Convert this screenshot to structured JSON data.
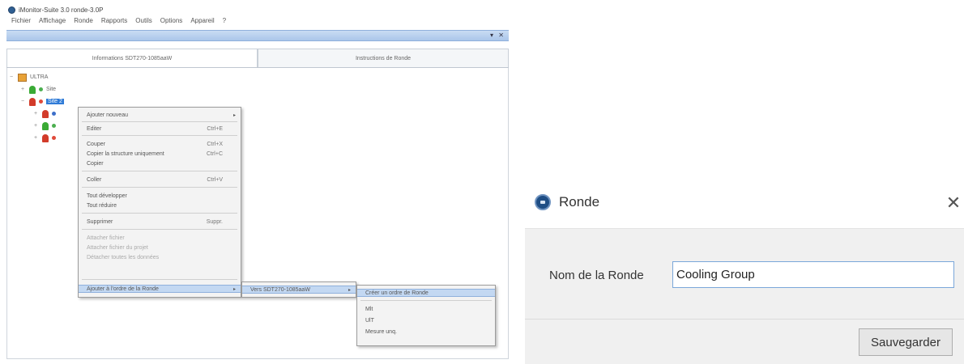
{
  "left_window": {
    "title": "iMonitor-Suite 3.0 ronde-3.0P",
    "menu": [
      "Fichier",
      "Affichage",
      "Ronde",
      "Rapports",
      "Outils",
      "Options",
      "Appareil",
      "?"
    ],
    "window_controls": "▾ ✕",
    "tabs": [
      {
        "label": "Informations SDT270-1085aaW",
        "active": true
      },
      {
        "label": "Instructions de Ronde",
        "active": false
      }
    ],
    "tree": {
      "root": "ULTRA",
      "child1": "Site",
      "child2_selected": "Site 2"
    },
    "context_menu": {
      "items": [
        {
          "label": "Ajouter nouveau",
          "shortcut": "",
          "submenu": true
        },
        {
          "label": "Editer",
          "shortcut": "Ctrl+E"
        },
        {
          "label": "Couper",
          "shortcut": "Ctrl+X"
        },
        {
          "label": "Copier la structure uniquement",
          "shortcut": "Ctrl+C"
        },
        {
          "label": "Copier",
          "shortcut": ""
        },
        {
          "label": "Coller",
          "shortcut": "Ctrl+V"
        },
        {
          "label": "Tout développer",
          "shortcut": ""
        },
        {
          "label": "Tout réduire",
          "shortcut": ""
        },
        {
          "label": "Supprimer",
          "shortcut": "Suppr."
        },
        {
          "label": "Attacher fichier",
          "shortcut": "",
          "disabled": true
        },
        {
          "label": "Attacher fichier du projet",
          "shortcut": "",
          "disabled": true
        },
        {
          "label": "Détacher toutes les données",
          "shortcut": "",
          "disabled": true
        },
        {
          "label": "Ajouter à l'ordre de la Ronde",
          "shortcut": "",
          "submenu": true,
          "highlighted": true
        }
      ],
      "submenu1": {
        "label": "Vers SDT270-1085aaW",
        "submenu": true
      },
      "submenu2": [
        {
          "label": "Créer un ordre de Ronde",
          "highlighted": true
        },
        {
          "label": "Mlt"
        },
        {
          "label": "UlT"
        },
        {
          "label": "Mesure unq."
        }
      ]
    }
  },
  "dialog": {
    "title": "Ronde",
    "close_glyph": "✕",
    "field_label": "Nom de la Ronde",
    "field_value": "Cooling Group",
    "save_label": "Sauvegarder"
  }
}
